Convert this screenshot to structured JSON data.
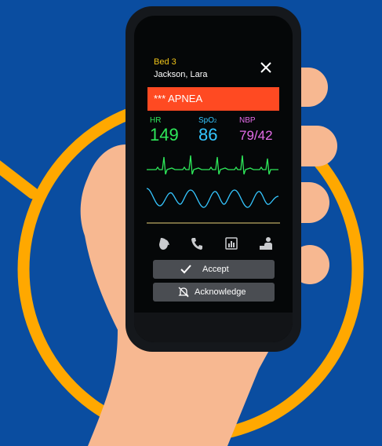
{
  "colors": {
    "background": "#0a4da0",
    "ring": "#ffa800",
    "skin": "#f7b891",
    "alarm": "#ff4a22",
    "hr": "#2ee85a",
    "spo2": "#35c6ff",
    "nbp": "#e46ce8",
    "bed_label": "#f0c419",
    "separator": "#e6d27a"
  },
  "alert": {
    "bed": "Bed 3",
    "patient": "Jackson, Lara",
    "close_icon": "close-icon",
    "alarm_text": "*** APNEA"
  },
  "vitals": {
    "hr": {
      "label": "HR",
      "value": "149"
    },
    "spo2": {
      "label_main": "SpO",
      "label_sub": "2",
      "value": "86"
    },
    "nbp": {
      "label": "NBP",
      "value": "79/42"
    }
  },
  "waveforms": [
    "ecg",
    "pleth"
  ],
  "actions": {
    "icons": [
      "voice-call-icon",
      "phone-icon",
      "chart-icon",
      "caregiver-icon"
    ],
    "accept": {
      "label": "Accept",
      "icon": "check-icon"
    },
    "acknowledge": {
      "label": "Acknowledge",
      "icon": "bell-off-icon"
    }
  }
}
